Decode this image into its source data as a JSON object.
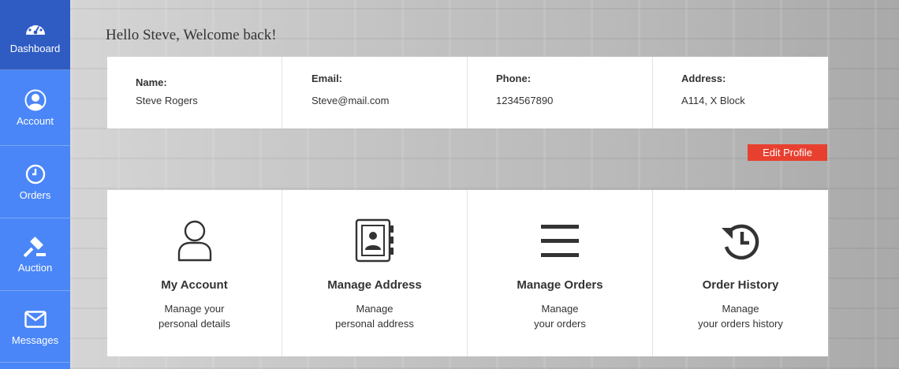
{
  "sidebar": {
    "items": [
      {
        "label": "Dashboard",
        "icon": "dashboard-icon"
      },
      {
        "label": "Account",
        "icon": "account-icon"
      },
      {
        "label": "Orders",
        "icon": "clock-icon"
      },
      {
        "label": "Auction",
        "icon": "gavel-icon"
      },
      {
        "label": "Messages",
        "icon": "envelope-icon"
      }
    ]
  },
  "greeting": "Hello Steve, Welcome back!",
  "profile": {
    "name_label": "Name:",
    "name_value": "Steve Rogers",
    "email_label": "Email:",
    "email_value": "Steve@mail.com",
    "phone_label": "Phone:",
    "phone_value": "1234567890",
    "address_label": "Address:",
    "address_value": "A114, X Block"
  },
  "edit_profile_label": "Edit Profile",
  "cards": [
    {
      "title": "My Account",
      "line1": "Manage your",
      "line2": "personal details",
      "icon": "user-icon"
    },
    {
      "title": "Manage Address",
      "line1": "Manage",
      "line2": "personal address",
      "icon": "address-book-icon"
    },
    {
      "title": "Manage Orders",
      "line1": "Manage",
      "line2": "your orders",
      "icon": "menu-lines-icon"
    },
    {
      "title": "Order History",
      "line1": "Manage",
      "line2": "your orders history",
      "icon": "history-icon"
    }
  ],
  "colors": {
    "sidebar": "#4a86f7",
    "sidebar_active": "#2f5cc3",
    "edit_button": "#e8402f"
  }
}
